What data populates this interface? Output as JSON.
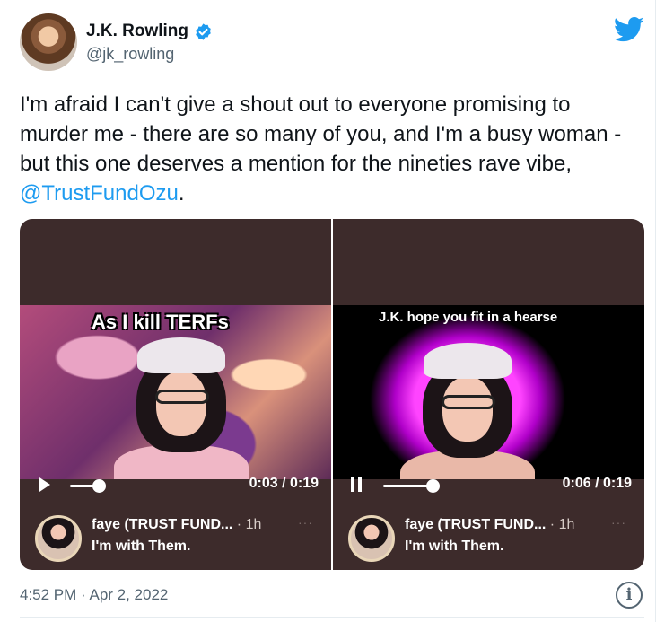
{
  "tweet": {
    "author": {
      "display_name": "J.K. Rowling",
      "handle": "@jk_rowling",
      "verified": true
    },
    "text_before_mention": "I'm afraid I can't give a shout out to everyone promising to murder me - there are so many of you, and I'm a busy woman - but this one deserves a mention for the nineties rave vibe, ",
    "mention": "@TrustFundOzu",
    "text_after_mention": ".",
    "timestamp": "4:52 PM · Apr 2, 2022",
    "source_icon": "twitter-bird-icon",
    "info_icon_glyph": "i",
    "brand_color": "#1d9bf0"
  },
  "media": [
    {
      "overlay_text": "As I kill TERFs",
      "playback": "paused",
      "time": "0:03 / 0:19",
      "progress": 0.16,
      "account_name": "faye (TRUST FUND...",
      "account_age": " · 1h",
      "more_glyph": "···",
      "caption": "I'm with Them."
    },
    {
      "overlay_text": "J.K. hope you fit in a hearse",
      "playback": "playing",
      "time": "0:06 / 0:19",
      "progress": 0.32,
      "account_name": "faye (TRUST FUND...",
      "account_age": " · 1h",
      "more_glyph": "···",
      "caption": "I'm with Them."
    }
  ]
}
